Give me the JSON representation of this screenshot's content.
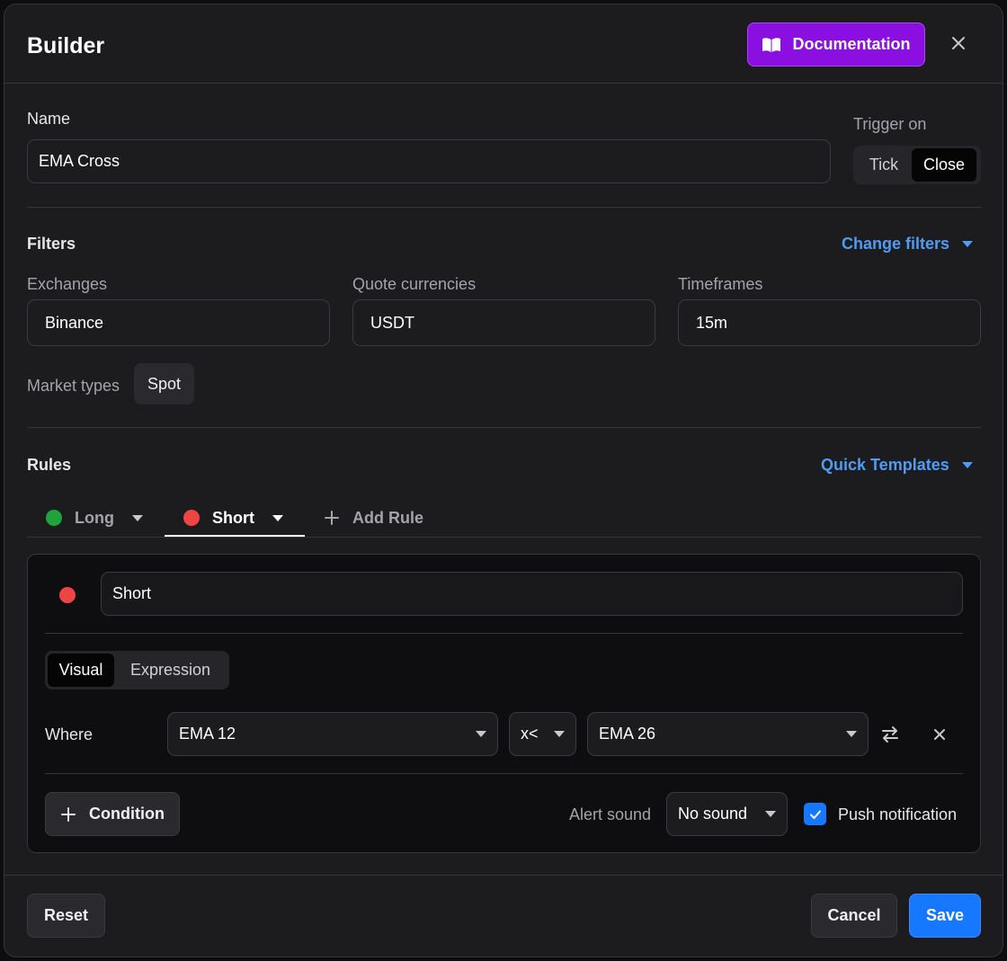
{
  "header": {
    "title": "Builder",
    "documentation_label": "Documentation",
    "icons": {
      "documentation": "book-open-icon",
      "close": "close-icon"
    }
  },
  "name_section": {
    "label": "Name",
    "value": "EMA Cross",
    "trigger_label": "Trigger on",
    "trigger_options": [
      "Tick",
      "Close"
    ],
    "trigger_selected": "Close"
  },
  "filters": {
    "title": "Filters",
    "change_label": "Change filters",
    "exchanges_label": "Exchanges",
    "exchanges_value": "Binance",
    "quote_label": "Quote currencies",
    "quote_value": "USDT",
    "timeframes_label": "Timeframes",
    "timeframes_value": "15m",
    "market_types_label": "Market types",
    "market_types_chip": "Spot"
  },
  "rules": {
    "title": "Rules",
    "templates_label": "Quick Templates",
    "tabs": [
      {
        "label": "Long",
        "color": "#1fa33d",
        "active": false
      },
      {
        "label": "Short",
        "color": "#ef4444",
        "active": true
      }
    ],
    "add_rule_label": "Add Rule",
    "active_rule": {
      "name": "Short",
      "color": "#ef4444",
      "mode_options": [
        "Visual",
        "Expression"
      ],
      "mode_selected": "Visual",
      "condition": {
        "where_label": "Where",
        "left": "EMA 12",
        "operator": "x<",
        "right": "EMA 26"
      },
      "condition_button": "Condition",
      "alert_sound_label": "Alert sound",
      "alert_sound_value": "No sound",
      "push_label": "Push notification",
      "push_checked": true
    }
  },
  "footer": {
    "reset_label": "Reset",
    "cancel_label": "Cancel",
    "save_label": "Save"
  },
  "colors": {
    "accent_blue": "#1677ff",
    "link_blue": "#4f9cf5",
    "doc_purple": "#8b0fe0",
    "long_green": "#1fa33d",
    "short_red": "#ef4444"
  }
}
